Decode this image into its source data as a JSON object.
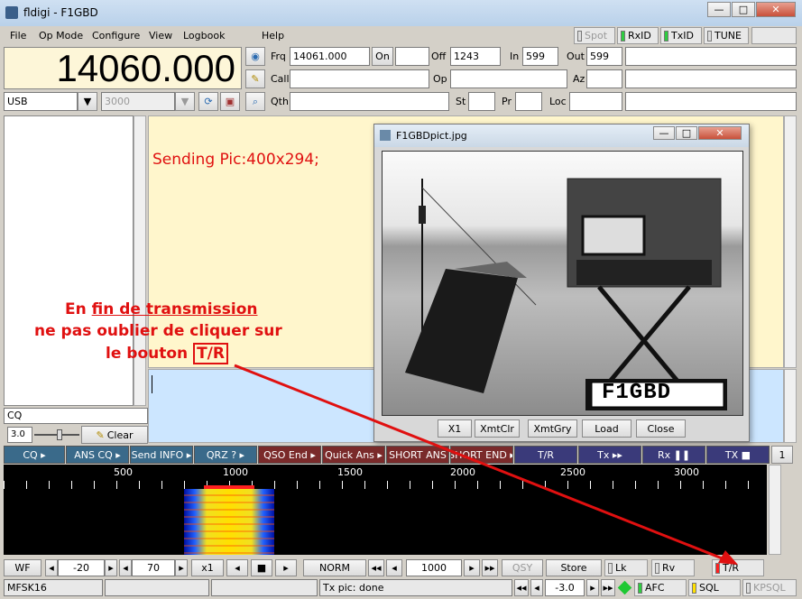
{
  "window": {
    "title": "fldigi - F1GBD",
    "controls": [
      "—",
      "□",
      "✕"
    ]
  },
  "menu": [
    "File",
    "Op Mode",
    "Configure",
    "View",
    "Logbook",
    "Help"
  ],
  "indicators": {
    "spot": "Spot",
    "rxid": "RxID",
    "txid": "TxID",
    "tune": "TUNE"
  },
  "freq_display": "14060.000",
  "mode_select": "USB",
  "bw_select": "3000",
  "log": {
    "frq_label": "Frq",
    "frq": "14061.000",
    "on_label": "On",
    "off_label": "Off",
    "off": "1243",
    "in_label": "In",
    "in": "599",
    "out_label": "Out",
    "out": "599",
    "call_label": "Call",
    "op_label": "Op",
    "az_label": "Az",
    "qth_label": "Qth",
    "st_label": "St",
    "pr_label": "Pr",
    "loc_label": "Loc"
  },
  "rx_text": "Sending Pic:400x294;",
  "annotation": {
    "line1a": "En ",
    "line1b": "fin de transmission",
    "line2": "ne pas oublier de cliquer sur",
    "line3a": "le bouton ",
    "line3b": "T/R"
  },
  "qso_input": "CQ",
  "squelch_value": "3.0",
  "clear_label": "Clear",
  "pic_window": {
    "title": "F1GBDpict.jpg",
    "plate": "F1GBD",
    "buttons": [
      "X1",
      "XmtClr",
      "XmtGry",
      "Load",
      "Close"
    ]
  },
  "macros": [
    "CQ",
    "ANS CQ",
    "Send INFO",
    "QRZ ?",
    "QSO End",
    "Quick Ans",
    "SHORT ANS",
    "SHORT END",
    "T/R",
    "Tx",
    "Rx",
    "TX"
  ],
  "macro_page": "1",
  "scale": [
    "500",
    "1000",
    "1500",
    "2000",
    "2500",
    "3000"
  ],
  "wf": {
    "wf_label": "WF",
    "ref": "-20",
    "range": "70",
    "zoom": "x1",
    "norm": "NORM",
    "carrier": "1000",
    "qsy": "QSY",
    "store": "Store",
    "lk": "Lk",
    "rv": "Rv",
    "tr": "T/R"
  },
  "status": {
    "mode": "MFSK16",
    "msg": "Tx pic: done",
    "s2n": "-3.0",
    "afc": "AFC",
    "sql": "SQL",
    "kpsql": "KPSQL"
  },
  "colors": {
    "rx_bg": "#fff6cc",
    "tx_bg": "#cce6ff",
    "accent": "#e01010"
  }
}
